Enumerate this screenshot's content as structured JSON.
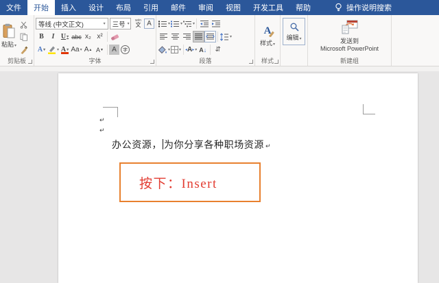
{
  "titlebar": {
    "tabs": [
      {
        "label": "文件"
      },
      {
        "label": "开始"
      },
      {
        "label": "插入"
      },
      {
        "label": "设计"
      },
      {
        "label": "布局"
      },
      {
        "label": "引用"
      },
      {
        "label": "邮件"
      },
      {
        "label": "审阅"
      },
      {
        "label": "视图"
      },
      {
        "label": "开发工具"
      },
      {
        "label": "帮助"
      }
    ],
    "search_label": "操作说明搜索"
  },
  "ribbon": {
    "clipboard": {
      "paste_label": "粘贴",
      "group_label": "剪贴板"
    },
    "font": {
      "name_value": "等线 (中文正文)",
      "size_value": "三号",
      "phonetic_small": "wén",
      "phonetic_char": "文",
      "char_border_letter": "A",
      "bold": "B",
      "italic": "I",
      "underline": "U",
      "strikethrough": "abc",
      "subscript": "x₂",
      "superscript": "x²",
      "effects_letter": "A",
      "color_letter": "A",
      "case_label": "Aa",
      "grow_letter": "A",
      "shrink_letter": "A",
      "shading_letter": "A",
      "enclose_letter": "字",
      "group_label": "字体"
    },
    "paragraph": {
      "scale_letter": "A",
      "sort_letter": "A",
      "sort_arrow": "↓",
      "marks_glyph": "⇵",
      "group_label": "段落"
    },
    "styles": {
      "icon_letter": "A",
      "button_label": "样式",
      "group_label": "样式"
    },
    "editing": {
      "button_label": "编辑"
    },
    "newgroup": {
      "button_line1": "发送到",
      "button_line2": "Microsoft PowerPoint",
      "group_label": "新建组"
    }
  },
  "document": {
    "para_mark": "↵",
    "text_before_cursor": "办公资源，",
    "text_after_cursor": "为你分享各种职场资源",
    "box_text": "按下：Insert"
  },
  "colors": {
    "title_blue": "#2b579a",
    "ribbon_bg": "#f9f8f7",
    "doc_bg": "#e7e6e6",
    "box_border_orange": "#e8802e",
    "box_text_red": "#e23b30",
    "highlight_yellow": "#ffe400",
    "font_color_red": "#e03400"
  }
}
